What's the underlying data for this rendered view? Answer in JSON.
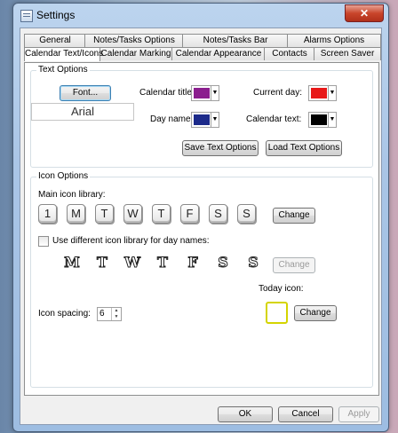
{
  "window": {
    "title": "Settings",
    "close_glyph": "✕"
  },
  "tabs_row1": [
    "General",
    "Notes/Tasks Options",
    "Notes/Tasks Bar",
    "Alarms Options"
  ],
  "tabs_row2": [
    "Calendar Text/Icons",
    "Calendar Marking",
    "Calendar Appearance",
    "Contacts",
    "Screen Saver"
  ],
  "active_tab": "Calendar Text/Icons",
  "text_options": {
    "legend": "Text Options",
    "font_button": "Font...",
    "font_preview": "Arial",
    "calendar_title_label": "Calendar title:",
    "calendar_title_color": "#8b1e8e",
    "current_day_label": "Current day:",
    "current_day_color": "#e81818",
    "day_names_label": "Day names:",
    "day_names_color": "#1c2a8a",
    "calendar_text_label": "Calendar text:",
    "calendar_text_color": "#000000",
    "save_button": "Save Text Options",
    "load_button": "Load Text Options"
  },
  "icon_options": {
    "legend": "Icon Options",
    "main_library_label": "Main icon library:",
    "main_icons": [
      "1",
      "M",
      "T",
      "W",
      "T",
      "F",
      "S",
      "S"
    ],
    "change_button": "Change",
    "different_library_label": "Use different icon library for day names:",
    "different_library_checked": false,
    "day_icons": [
      "M",
      "T",
      "W",
      "T",
      "F",
      "S",
      "S"
    ],
    "change_button_2": "Change",
    "today_icon_label": "Today icon:",
    "change_button_3": "Change",
    "spacing_label": "Icon spacing:",
    "spacing_value": "6"
  },
  "footer": {
    "ok": "OK",
    "cancel": "Cancel",
    "apply": "Apply"
  }
}
